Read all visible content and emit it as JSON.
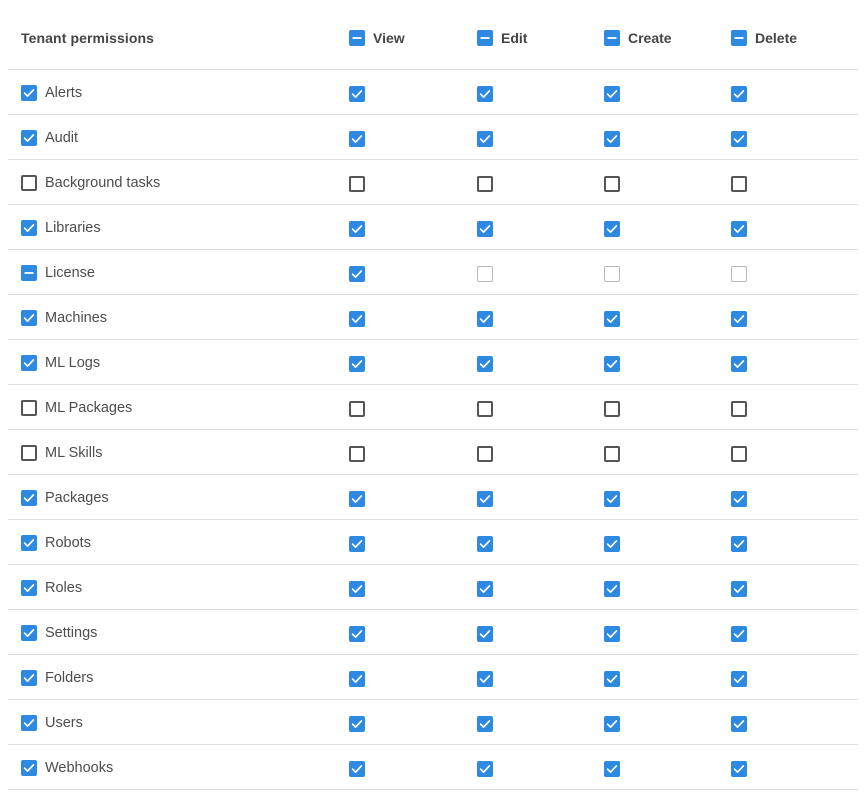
{
  "header": {
    "title": "Tenant permissions",
    "columns": [
      {
        "label": "View",
        "state": "indeterminate"
      },
      {
        "label": "Edit",
        "state": "indeterminate"
      },
      {
        "label": "Create",
        "state": "indeterminate"
      },
      {
        "label": "Delete",
        "state": "indeterminate"
      }
    ]
  },
  "rows": [
    {
      "label": "Alerts",
      "state": "checked",
      "view": "checked",
      "edit": "checked",
      "create": "checked",
      "delete": "checked"
    },
    {
      "label": "Audit",
      "state": "checked",
      "view": "checked",
      "edit": "checked",
      "create": "checked",
      "delete": "checked"
    },
    {
      "label": "Background tasks",
      "state": "unchecked",
      "view": "unchecked",
      "edit": "unchecked",
      "create": "unchecked",
      "delete": "unchecked"
    },
    {
      "label": "Libraries",
      "state": "checked",
      "view": "checked",
      "edit": "checked",
      "create": "checked",
      "delete": "checked"
    },
    {
      "label": "License",
      "state": "indeterminate",
      "view": "checked",
      "edit": "disabled",
      "create": "disabled",
      "delete": "disabled"
    },
    {
      "label": "Machines",
      "state": "checked",
      "view": "checked",
      "edit": "checked",
      "create": "checked",
      "delete": "checked"
    },
    {
      "label": "ML Logs",
      "state": "checked",
      "view": "checked",
      "edit": "checked",
      "create": "checked",
      "delete": "checked"
    },
    {
      "label": "ML Packages",
      "state": "unchecked",
      "view": "unchecked",
      "edit": "unchecked",
      "create": "unchecked",
      "delete": "unchecked"
    },
    {
      "label": "ML Skills",
      "state": "unchecked",
      "view": "unchecked",
      "edit": "unchecked",
      "create": "unchecked",
      "delete": "unchecked"
    },
    {
      "label": "Packages",
      "state": "checked",
      "view": "checked",
      "edit": "checked",
      "create": "checked",
      "delete": "checked"
    },
    {
      "label": "Robots",
      "state": "checked",
      "view": "checked",
      "edit": "checked",
      "create": "checked",
      "delete": "checked"
    },
    {
      "label": "Roles",
      "state": "checked",
      "view": "checked",
      "edit": "checked",
      "create": "checked",
      "delete": "checked"
    },
    {
      "label": "Settings",
      "state": "checked",
      "view": "checked",
      "edit": "checked",
      "create": "checked",
      "delete": "checked"
    },
    {
      "label": "Folders",
      "state": "checked",
      "view": "checked",
      "edit": "checked",
      "create": "checked",
      "delete": "checked"
    },
    {
      "label": "Users",
      "state": "checked",
      "view": "checked",
      "edit": "checked",
      "create": "checked",
      "delete": "checked"
    },
    {
      "label": "Webhooks",
      "state": "checked",
      "view": "checked",
      "edit": "checked",
      "create": "checked",
      "delete": "checked"
    }
  ],
  "colors": {
    "accent": "#2d8ae0",
    "border": "#555555",
    "disabled_border": "#b8b8b8",
    "divider": "#e0e0e0"
  }
}
